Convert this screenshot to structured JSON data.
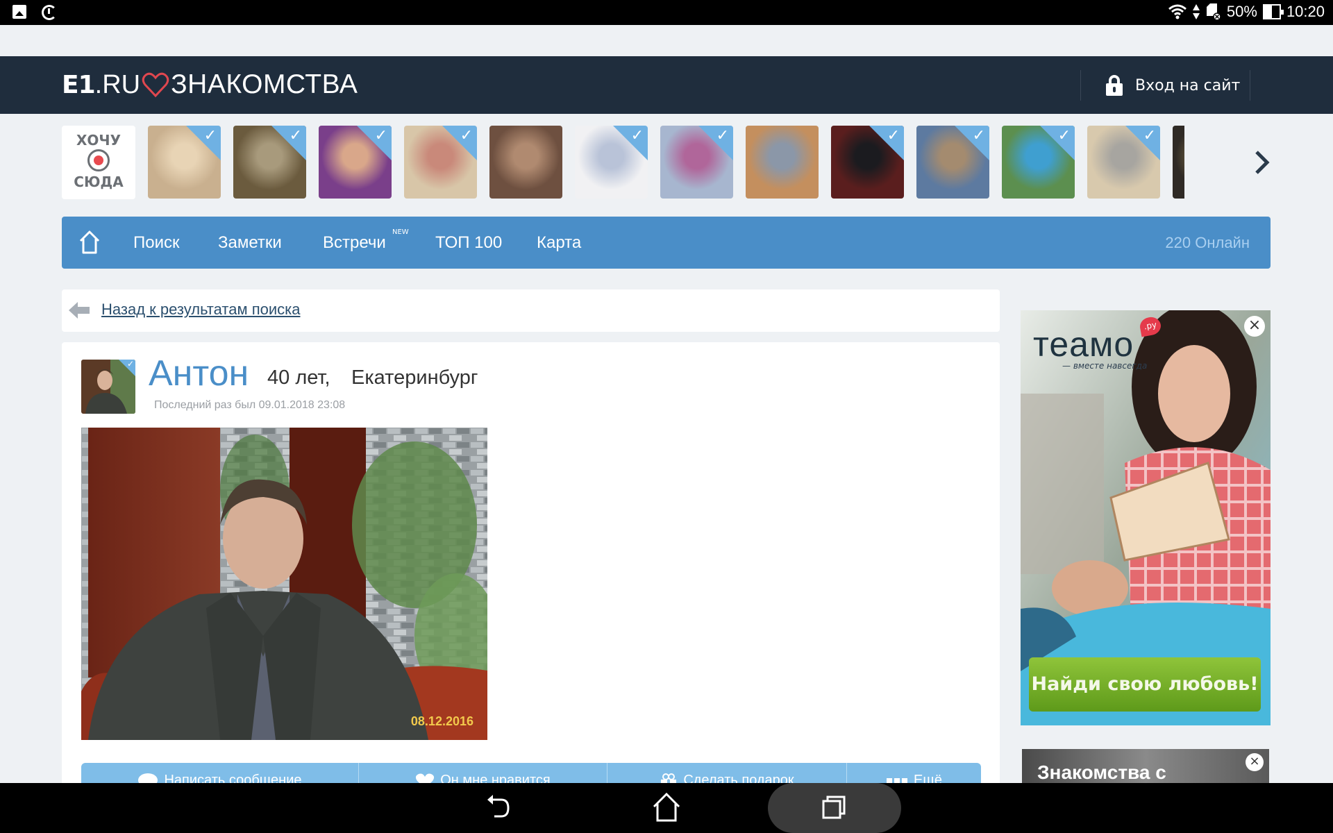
{
  "status_bar": {
    "left_icons": [
      "image-notification-icon",
      "system-update-icon"
    ],
    "right_icons": [
      "wifi-icon",
      "data-transfer-icon",
      "sd-card-error-icon",
      "battery-icon"
    ],
    "battery_percent": "50%",
    "battery_level": 0.5,
    "time": "10:20"
  },
  "header": {
    "logo_e1": "E1",
    "logo_ru": ".RU",
    "logo_section": "ЗНАКОМСТВА",
    "login_label": "Вход на сайт",
    "brand_color": "#1f2d3d",
    "heart_color": "#e0474f"
  },
  "carousel": {
    "want_here": {
      "line1": "ХОЧУ",
      "line2": "СЮДА"
    },
    "thumbnails": [
      {
        "verified": true,
        "colors": [
          "#c9b08f",
          "#e8d4b5"
        ]
      },
      {
        "verified": true,
        "colors": [
          "#6b5b3e",
          "#a89a7c"
        ]
      },
      {
        "verified": true,
        "colors": [
          "#7a3f8a",
          "#d9a78a"
        ]
      },
      {
        "verified": true,
        "colors": [
          "#d8c6a8",
          "#c9897a"
        ]
      },
      {
        "verified": false,
        "colors": [
          "#6e5040",
          "#b08a70"
        ]
      },
      {
        "verified": true,
        "colors": [
          "#f1f1f3",
          "#b9c3d8"
        ]
      },
      {
        "verified": true,
        "colors": [
          "#a7b6cf",
          "#b0669a"
        ]
      },
      {
        "verified": false,
        "colors": [
          "#c48f5e",
          "#8b97a8"
        ]
      },
      {
        "verified": true,
        "colors": [
          "#5a1e1e",
          "#1b1b1f"
        ]
      },
      {
        "verified": true,
        "colors": [
          "#5d7aa0",
          "#a48b6f"
        ]
      },
      {
        "verified": true,
        "colors": [
          "#5c8f4f",
          "#3f9fd0"
        ]
      },
      {
        "verified": true,
        "colors": [
          "#d8c9ad",
          "#a7a5a0"
        ]
      },
      {
        "verified": false,
        "colors": [
          "#2f2a25",
          "#7a6a45"
        ]
      }
    ],
    "next_icon": "chevron-right-icon"
  },
  "nav": {
    "home_icon": "home-icon",
    "items": [
      {
        "label": "Поиск"
      },
      {
        "label": "Заметки"
      },
      {
        "label": "Встречи",
        "badge": "NEW"
      },
      {
        "label": "ТОП 100"
      },
      {
        "label": "Карта"
      }
    ],
    "online": "220 Онлайн",
    "color": "#4a8ec8"
  },
  "back": {
    "label": "Назад к результатам поиска"
  },
  "profile": {
    "name": "Антон",
    "age": "40 лет,",
    "city": "Екатеринбург",
    "last_seen": "Последний раз был 09.01.2018 23:08",
    "verified": true,
    "photo_date": "08.12.2016",
    "actions": [
      {
        "label": "Написать сообщение",
        "icon": "speech-bubble-icon"
      },
      {
        "label": "Он мне нравится",
        "icon": "heart-icon"
      },
      {
        "label": "Сделать подарок",
        "icon": "gift-icon"
      },
      {
        "label": "Ещё",
        "icon": "more-dots-icon"
      }
    ]
  },
  "ads": {
    "teamo": {
      "logo": "теамо",
      "logo_suffix": ".ру",
      "tagline": "— вместе навсегда",
      "cta": "Найди свою любовь!"
    },
    "second": {
      "title": "Знакомства с"
    }
  },
  "android_nav": {
    "buttons": [
      "back-icon",
      "home-icon",
      "recent-apps-icon"
    ]
  }
}
